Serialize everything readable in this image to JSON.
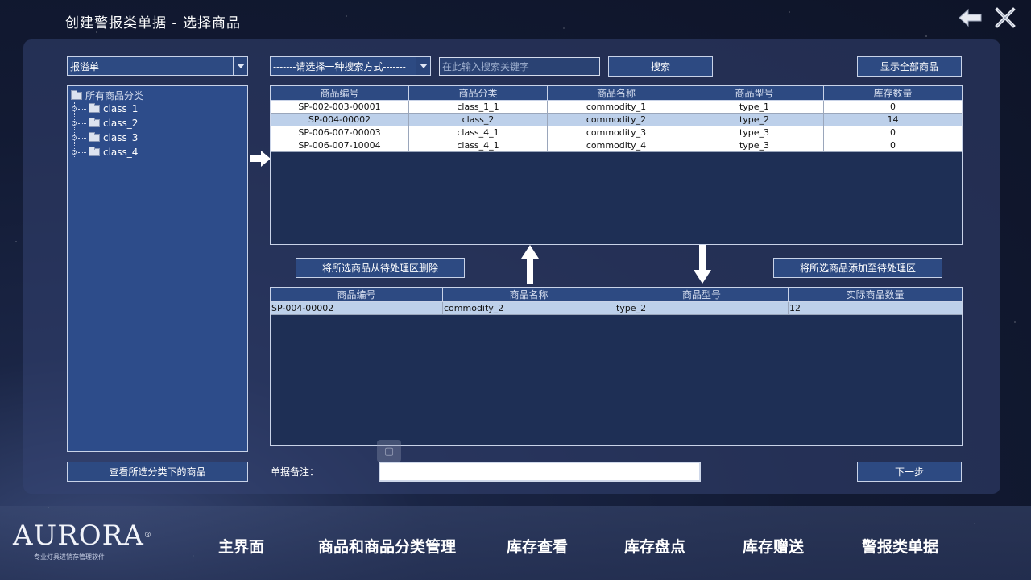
{
  "title": "创建警报类单据 - 选择商品",
  "window_controls": {
    "back": "back-arrow-icon",
    "close": "close-x-icon"
  },
  "bill_type": {
    "selected": "报溢单",
    "icon": "chevron-down-icon"
  },
  "search": {
    "method_selected": "-------请选择一种搜索方式-------",
    "keyword_placeholder": "在此输入搜索关键字",
    "search_button": "搜索",
    "show_all_button": "显示全部商品"
  },
  "category_tree": {
    "root": "所有商品分类",
    "items": [
      "class_1",
      "class_2",
      "class_3",
      "class_4"
    ]
  },
  "view_category_button": "查看所选分类下的商品",
  "commodity_table": {
    "headers": [
      "商品编号",
      "商品分类",
      "商品名称",
      "商品型号",
      "库存数量"
    ],
    "rows": [
      [
        "SP-002-003-00001",
        "class_1_1",
        "commodity_1",
        "type_1",
        "0"
      ],
      [
        "SP-004-00002",
        "class_2",
        "commodity_2",
        "type_2",
        "14"
      ],
      [
        "SP-006-007-00003",
        "class_4_1",
        "commodity_3",
        "type_3",
        "0"
      ],
      [
        "SP-006-007-10004",
        "class_4_1",
        "commodity_4",
        "type_3",
        "0"
      ]
    ],
    "selected_row": 1
  },
  "remove_button": "将所选商品从待处理区删除",
  "add_button": "将所选商品添加至待处理区",
  "pending_table": {
    "headers": [
      "商品编号",
      "商品名称",
      "商品型号",
      "实际商品数量"
    ],
    "rows": [
      [
        "SP-004-00002",
        "commodity_2",
        "type_2",
        "12"
      ]
    ]
  },
  "note_label": "单据备注：",
  "note_value": "",
  "next_button": "下一步",
  "brand": {
    "name": "AURORA",
    "mark": "®",
    "tagline": "专业灯具进销存管理软件"
  },
  "nav": [
    "主界面",
    "商品和商品分类管理",
    "库存查看",
    "库存盘点",
    "库存赠送",
    "警报类单据"
  ]
}
